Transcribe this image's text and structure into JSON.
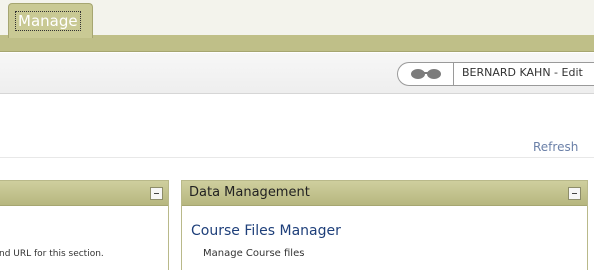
{
  "tabs": [
    {
      "label": "Manage"
    }
  ],
  "userbar": {
    "edit_mode_label": "BERNARD KAHN - Edit",
    "edit_mode_icon": "glasses-icon"
  },
  "main": {
    "refresh_label": "Refresh"
  },
  "panels": [
    {
      "title": "",
      "text": "nd URL for this section."
    },
    {
      "title": "Data Management",
      "items": [
        {
          "title": "Course Files Manager",
          "description": "Manage Course files"
        }
      ]
    }
  ],
  "colors": {
    "tab_bar": "#bfbf88",
    "panel_header": "#c3c38e",
    "link": "#1e3f7a",
    "refresh": "#6b80a8"
  }
}
